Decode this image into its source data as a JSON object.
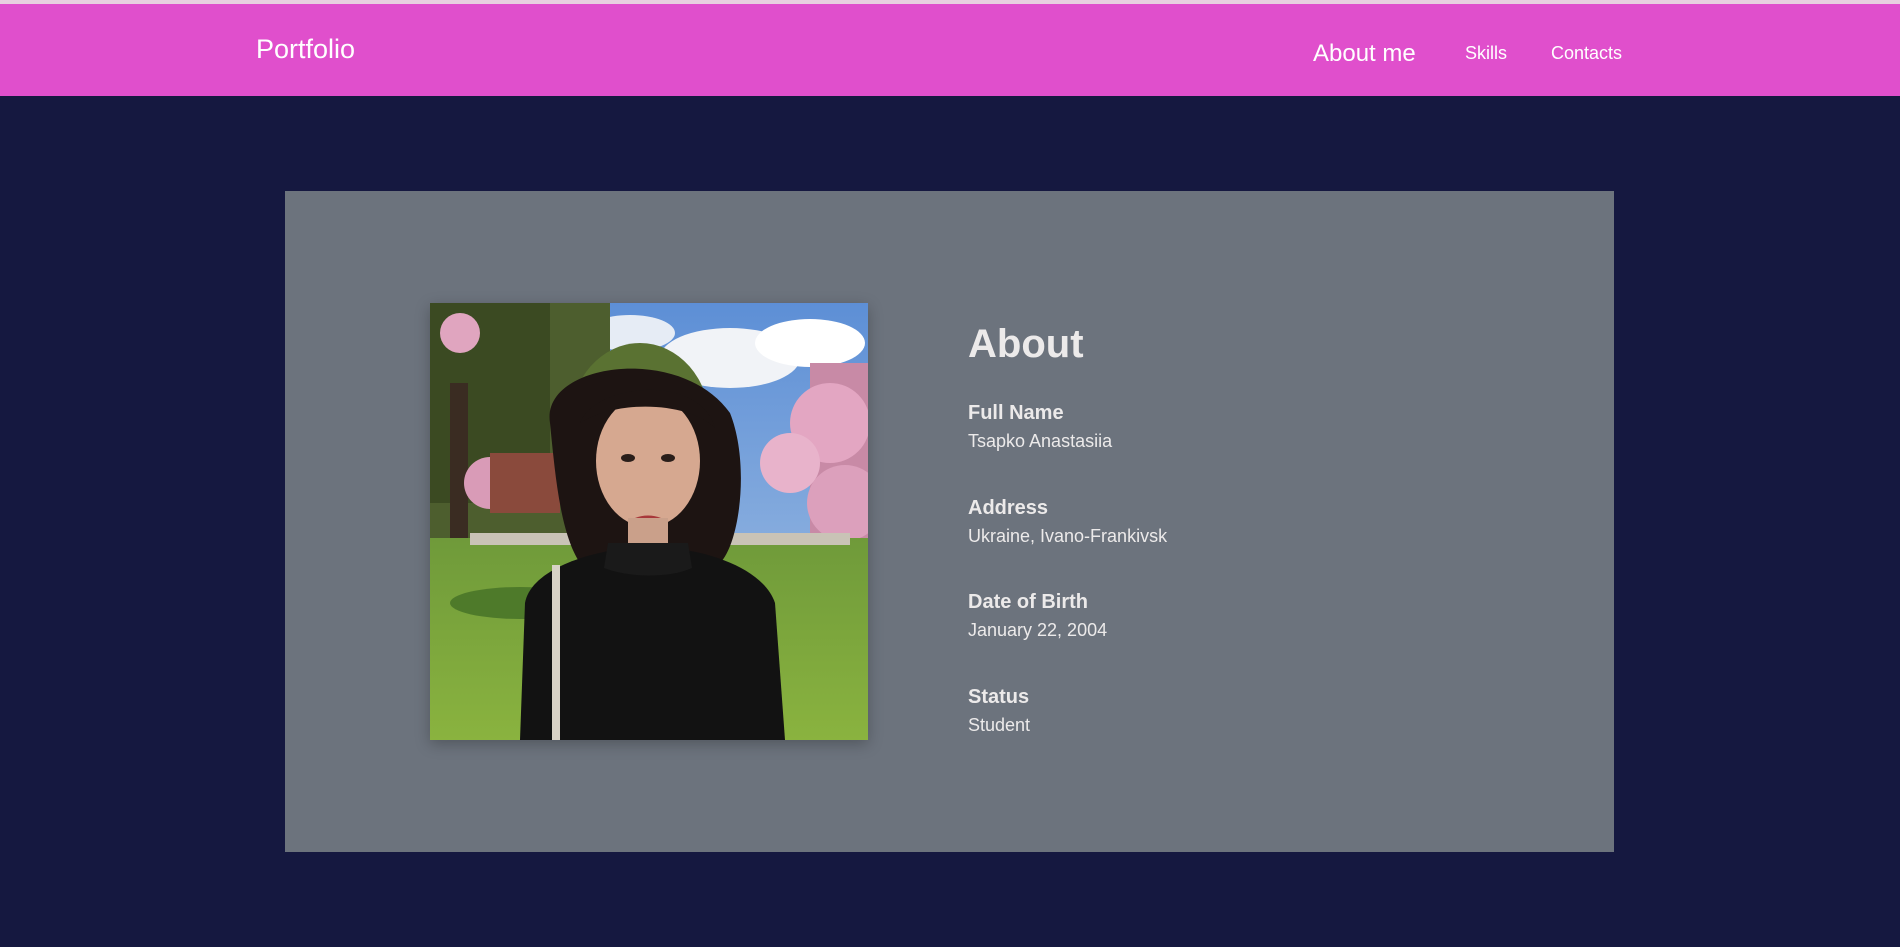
{
  "header": {
    "brand": "Portfolio",
    "nav": {
      "about": "About me",
      "skills": "Skills",
      "contacts": "Contacts"
    }
  },
  "about": {
    "title": "About",
    "photo_alt": "Portrait photo",
    "fields": [
      {
        "label": "Full Name",
        "value": "Tsapko Anastasiia"
      },
      {
        "label": "Address",
        "value": "Ukraine, Ivano-Frankivsk"
      },
      {
        "label": "Date of Birth",
        "value": "January 22, 2004"
      },
      {
        "label": "Status",
        "value": "Student"
      }
    ]
  },
  "colors": {
    "navbar": "#e04fcc",
    "background": "#151840",
    "card": "#6c737d",
    "text": "#eceaea"
  }
}
